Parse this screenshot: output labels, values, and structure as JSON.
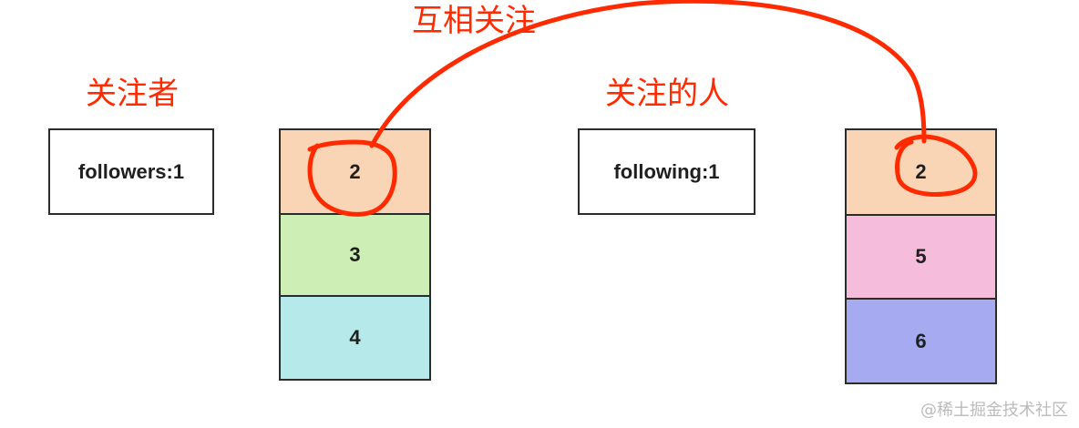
{
  "labels": {
    "mutual": "互相关注",
    "followers_title": "关注者",
    "following_title": "关注的人"
  },
  "left": {
    "key": "followers:1",
    "members": [
      {
        "value": "2",
        "color": "#f9d5b5"
      },
      {
        "value": "3",
        "color": "#cdeeb4"
      },
      {
        "value": "4",
        "color": "#b5e9ea"
      }
    ]
  },
  "right": {
    "key": "following:1",
    "members": [
      {
        "value": "2",
        "color": "#f9d5b5"
      },
      {
        "value": "5",
        "color": "#f5bcdc"
      },
      {
        "value": "6",
        "color": "#a6abf1"
      }
    ]
  },
  "annotation_color": "#ff2a00",
  "watermark": "@稀土掘金技术社区"
}
